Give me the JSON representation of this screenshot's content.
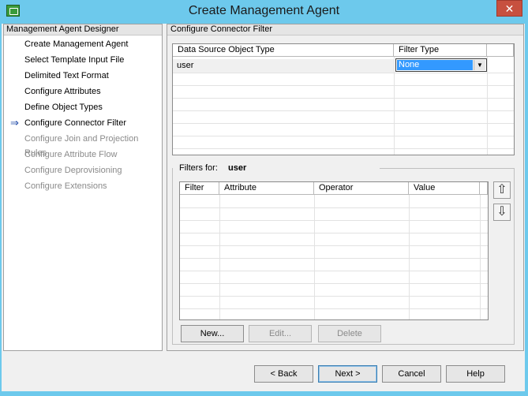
{
  "window": {
    "title": "Create Management Agent",
    "close_glyph": "✕"
  },
  "left_pane": {
    "header": "Management Agent Designer",
    "current_indicator": "⇒",
    "items": [
      {
        "label": "Create Management Agent"
      },
      {
        "label": "Select Template Input File"
      },
      {
        "label": "Delimited Text Format"
      },
      {
        "label": "Configure Attributes"
      },
      {
        "label": "Define Object Types"
      },
      {
        "label": "Configure Connector Filter"
      },
      {
        "label": "Configure Join and Projection Rules"
      },
      {
        "label": "Configure Attribute Flow"
      },
      {
        "label": "Configure Deprovisioning"
      },
      {
        "label": "Configure Extensions"
      }
    ]
  },
  "right_pane": {
    "header": "Configure Connector Filter",
    "object_grid": {
      "columns": [
        "Data Source Object Type",
        "Filter Type"
      ],
      "rows": [
        {
          "object_type": "user",
          "filter_type": "None"
        }
      ]
    },
    "filters": {
      "label": "Filters for:",
      "object": "user",
      "columns": [
        "Filter",
        "Attribute",
        "Operator",
        "Value"
      ],
      "move_up_glyph": "⇧",
      "move_down_glyph": "⇩",
      "new_label": "New...",
      "edit_label": "Edit...",
      "delete_label": "Delete"
    }
  },
  "footer": {
    "back_label": "< Back",
    "next_label": "Next >",
    "cancel_label": "Cancel",
    "help_label": "Help"
  }
}
